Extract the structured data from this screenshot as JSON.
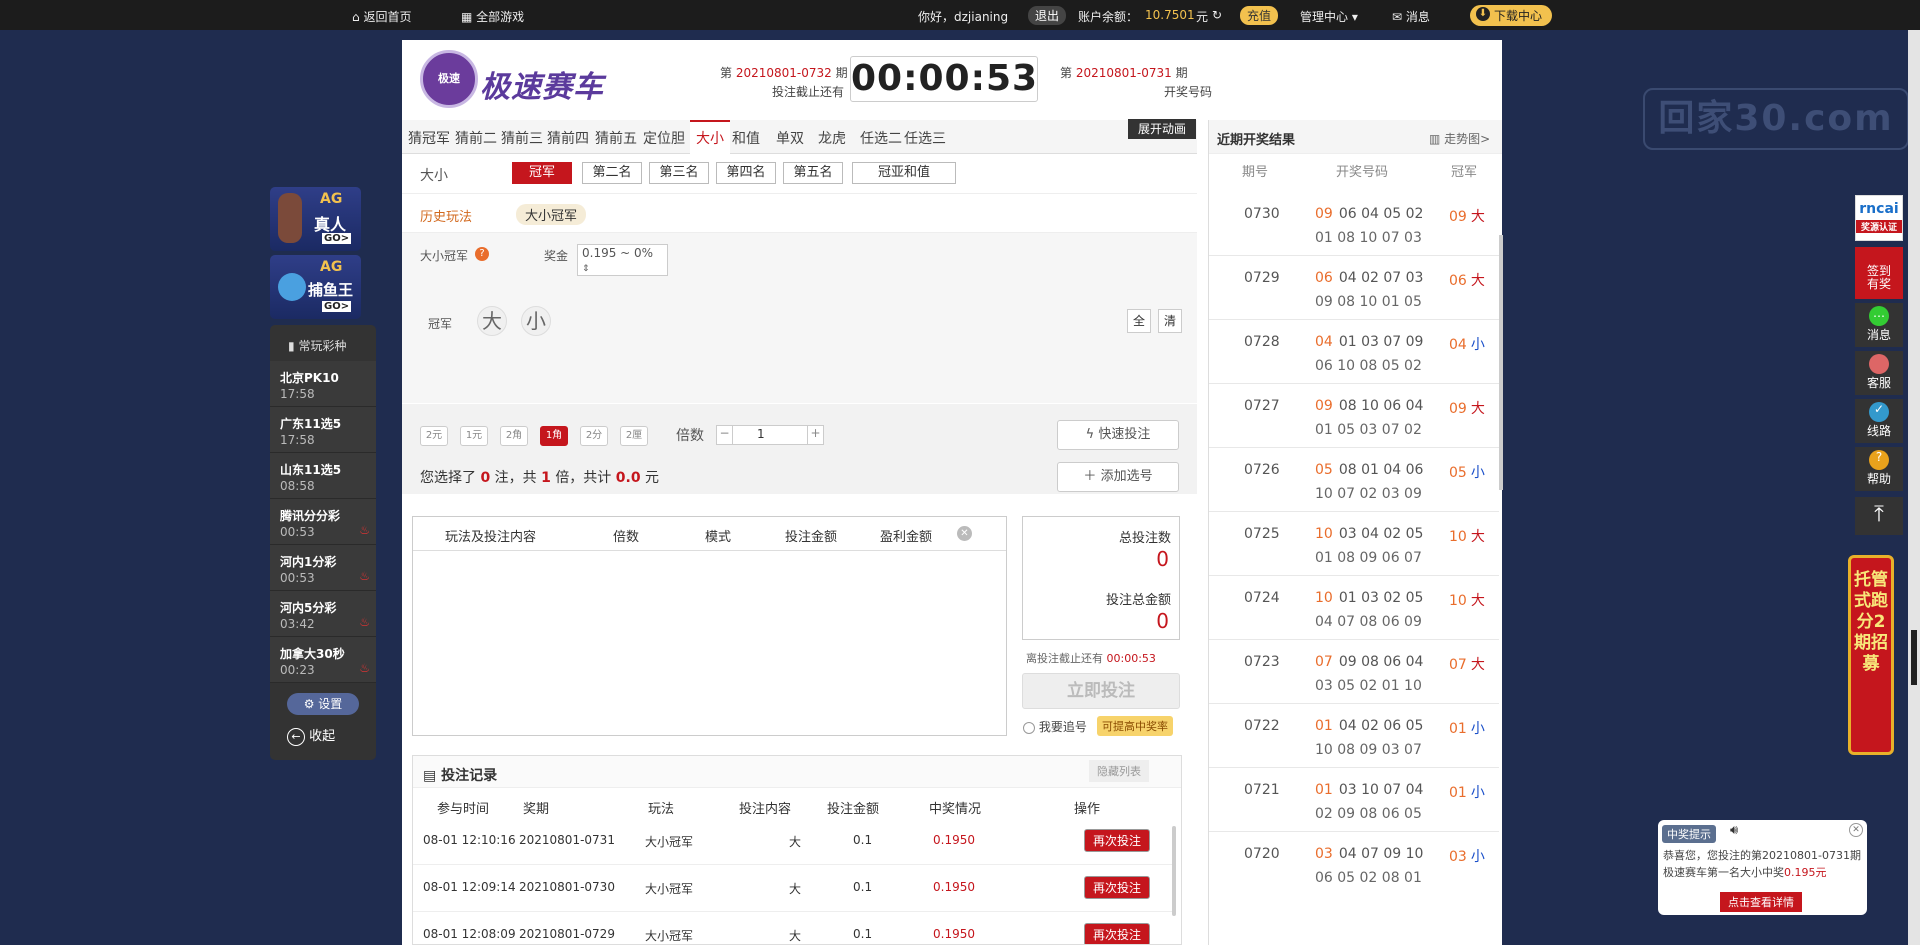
{
  "topbar": {
    "home": "返回首页",
    "all_games": "全部游戏",
    "greeting": "你好，dzjianing",
    "logout": "退出",
    "balance_label": "账户余额：",
    "balance_value": "10.7501",
    "balance_unit": "元",
    "recharge": "充值",
    "manage": "管理中心",
    "messages": "消息",
    "download": "下载中心"
  },
  "watermark": "回家30.com",
  "header": {
    "logo_badge": "极速",
    "logo_text": "极速赛车",
    "cur_prefix": "第",
    "cur_issue": "20210801-0732",
    "cur_suffix": "期",
    "cur_label": "投注截止还有",
    "countdown": "00:00:53",
    "prev_prefix": "第",
    "prev_issue": "20210801-0731",
    "prev_suffix": "期",
    "prev_label": "开奖号码",
    "anim_btn": "展开动画"
  },
  "tabs": [
    "猜冠军",
    "猜前二",
    "猜前三",
    "猜前四",
    "猜前五",
    "定位胆",
    "大小",
    "和值",
    "单双",
    "龙虎",
    "任选二",
    "任选三"
  ],
  "active_tab": "大小",
  "subrow": {
    "label": "大小",
    "positions": [
      "冠军",
      "第二名",
      "第三名",
      "第四名",
      "第五名",
      "冠亚和值"
    ],
    "selected": "冠军"
  },
  "history": {
    "label": "历史玩法",
    "tag": "大小冠军"
  },
  "bet": {
    "play_name": "大小冠军",
    "help": "?",
    "prize_label": "奖金",
    "prize_value": "0.195 ~ 0%",
    "row_label": "冠军",
    "big": "大",
    "small": "小",
    "all": "全",
    "clear": "清"
  },
  "mode": {
    "units": [
      "2元",
      "1元",
      "2角",
      "1角",
      "2分",
      "2厘"
    ],
    "selected_unit": "1角",
    "multiple_label": "倍数",
    "multiple_value": "1",
    "minus": "−",
    "plus": "+",
    "quick_bet": "快速投注",
    "add_number": "添加选号",
    "sel_text1": "您选择了",
    "sel_count": "0",
    "sel_text2": "注，共",
    "sel_times": "1",
    "sel_text3": "倍，共计",
    "sel_amount": "0.0",
    "sel_unit": "元"
  },
  "cart": {
    "headers": [
      "玩法及投注内容",
      "倍数",
      "模式",
      "投注金额",
      "盈利金额"
    ]
  },
  "summary": {
    "total_bets_label": "总投注数",
    "total_bets": "0",
    "total_amount_label": "投注总金额",
    "total_amount": "0",
    "deadline_label": "离投注截止还有",
    "deadline": "00:00:53",
    "bet_now": "立即投注",
    "chase": "我要追号",
    "tip": "可提高中奖率"
  },
  "records": {
    "title": "投注记录",
    "hide": "隐藏列表",
    "headers": [
      "参与时间",
      "奖期",
      "玩法",
      "投注内容",
      "投注金额",
      "中奖情况",
      "操作"
    ],
    "rows": [
      {
        "time": "08-01 12:10:16",
        "issue": "20210801-0731",
        "play": "大小冠军",
        "content": "大",
        "amount": "0.1",
        "win": "0.1950",
        "action": "再次投注"
      },
      {
        "time": "08-01 12:09:14",
        "issue": "20210801-0730",
        "play": "大小冠军",
        "content": "大",
        "amount": "0.1",
        "win": "0.1950",
        "action": "再次投注"
      },
      {
        "time": "08-01 12:08:09",
        "issue": "20210801-0729",
        "play": "大小冠军",
        "content": "大",
        "amount": "0.1",
        "win": "0.1950",
        "action": "再次投注"
      }
    ]
  },
  "results": {
    "title": "近期开奖结果",
    "trend": "走势图>",
    "headers": [
      "期号",
      "开奖号码",
      "冠军"
    ],
    "rows": [
      {
        "no": "0730",
        "first": "09",
        "rest1": "06 04 05 02",
        "rest2": "01 08 10 07 03",
        "champ": "09",
        "bs": "大"
      },
      {
        "no": "0729",
        "first": "06",
        "rest1": "04 02 07 03",
        "rest2": "09 08 10 01 05",
        "champ": "06",
        "bs": "大"
      },
      {
        "no": "0728",
        "first": "04",
        "rest1": "01 03 07 09",
        "rest2": "06 10 08 05 02",
        "champ": "04",
        "bs": "小"
      },
      {
        "no": "0727",
        "first": "09",
        "rest1": "08 10 06 04",
        "rest2": "01 05 03 07 02",
        "champ": "09",
        "bs": "大"
      },
      {
        "no": "0726",
        "first": "05",
        "rest1": "08 01 04 06",
        "rest2": "10 07 02 03 09",
        "champ": "05",
        "bs": "小"
      },
      {
        "no": "0725",
        "first": "10",
        "rest1": "03 04 02 05",
        "rest2": "01 08 09 06 07",
        "champ": "10",
        "bs": "大"
      },
      {
        "no": "0724",
        "first": "10",
        "rest1": "01 03 02 05",
        "rest2": "04 07 08 06 09",
        "champ": "10",
        "bs": "大"
      },
      {
        "no": "0723",
        "first": "07",
        "rest1": "09 08 06 04",
        "rest2": "03 05 02 01 10",
        "champ": "07",
        "bs": "大"
      },
      {
        "no": "0722",
        "first": "01",
        "rest1": "04 02 06 05",
        "rest2": "10 08 09 03 07",
        "champ": "01",
        "bs": "小"
      },
      {
        "no": "0721",
        "first": "01",
        "rest1": "03 10 07 04",
        "rest2": "02 09 08 06 05",
        "champ": "01",
        "bs": "小"
      },
      {
        "no": "0720",
        "first": "03",
        "rest1": "04 07 09 10",
        "rest2": "06 05 02 08 01",
        "champ": "03",
        "bs": "小"
      }
    ]
  },
  "left_panel": {
    "ag1_top": "AG",
    "ag1_main": "真人",
    "ag1_go": "GO>",
    "ag2_top": "AG",
    "ag2_main": "捕鱼王",
    "ag2_go": "GO>",
    "fav_title": "常玩彩种",
    "items": [
      {
        "name": "北京PK10",
        "time": "17:58",
        "hot": false
      },
      {
        "name": "广东11选5",
        "time": "17:58",
        "hot": false
      },
      {
        "name": "山东11选5",
        "time": "08:58",
        "hot": false
      },
      {
        "name": "腾讯分分彩",
        "time": "00:53",
        "hot": true
      },
      {
        "name": "河内1分彩",
        "time": "00:53",
        "hot": true
      },
      {
        "name": "河内5分彩",
        "time": "03:42",
        "hot": true
      },
      {
        "name": "加拿大30秒",
        "time": "00:23",
        "hot": true
      }
    ],
    "settings": "设置",
    "collapse": "收起"
  },
  "right_panel": {
    "cai": "rncai",
    "cert": "奖源认证",
    "signin1": "签到",
    "signin2": "有奖",
    "msg": "消息",
    "service": "客服",
    "route": "线路",
    "help": "帮助"
  },
  "banner": "托管式跑分2期招募",
  "popup": {
    "title": "中奖提示",
    "body": "恭喜您，您投注的第20210801-0731期极速赛车第一名大小中奖",
    "amount": "0.195元",
    "link": "点击查看详情"
  }
}
